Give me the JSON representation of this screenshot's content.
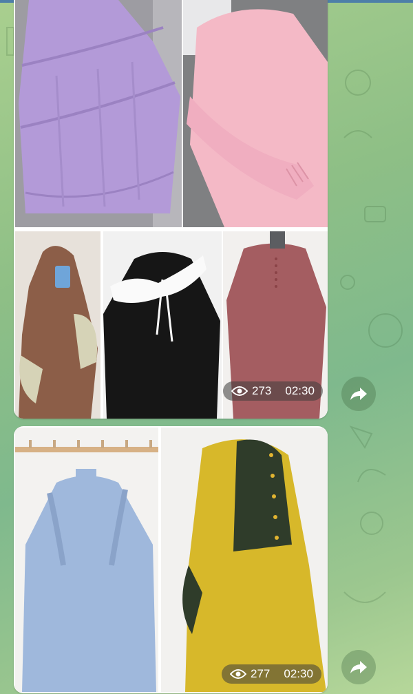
{
  "posts": [
    {
      "views": "273",
      "time": "02:30",
      "photos": [
        "lavender tiered dress",
        "pink dress with ruffled cuff",
        "brown hijab outfit",
        "black dress with white collar",
        "mauve dress with buttons"
      ]
    },
    {
      "views": "277",
      "time": "02:30",
      "photos": [
        "light blue dress with ruffles",
        "mustard dress with patterned yoke"
      ]
    }
  ],
  "icons": {
    "views": "eye-icon",
    "share": "forward-arrow-icon"
  },
  "colors": {
    "chat_background": "#8ebf86",
    "meta_pill": "rgba(60,60,60,0.55)"
  }
}
